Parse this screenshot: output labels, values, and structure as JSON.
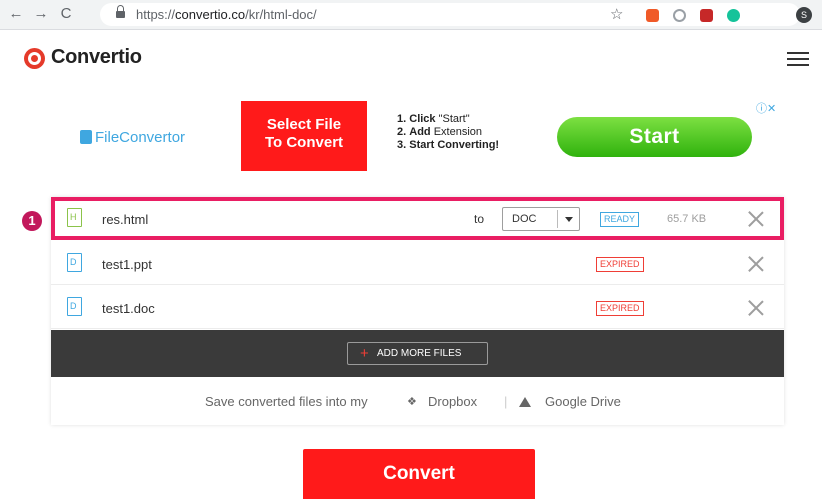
{
  "browser": {
    "url_prefix": "https://",
    "url_host": "convertio.co",
    "url_path": "/kr/html-doc/",
    "profile_initial": "S"
  },
  "site": {
    "logo": "Convertio"
  },
  "ad": {
    "brand": "FileConvertor",
    "cta_line1": "Select File",
    "cta_line2": "To Convert",
    "steps": [
      {
        "num": "1.",
        "bold": "Click",
        "rest": " \"Start\""
      },
      {
        "num": "2.",
        "bold": "Add",
        "rest": " Extension"
      },
      {
        "num": "3.",
        "bold": "Start Converting!",
        "rest": ""
      }
    ],
    "start_label": "Start",
    "adchoices": "ⓘ✕"
  },
  "files": [
    {
      "name": "res.html",
      "to_label": "to",
      "format": "DOC",
      "status": "READY",
      "size": "65.7 KB",
      "icon_letter": "H"
    },
    {
      "name": "test1.ppt",
      "status": "EXPIRED",
      "icon_letter": "D"
    },
    {
      "name": "test1.doc",
      "status": "EXPIRED",
      "icon_letter": "D"
    }
  ],
  "add_more": {
    "plus": "+",
    "label": "ADD MORE FILES"
  },
  "save": {
    "text": "Save converted files into my",
    "dropbox": "Dropbox",
    "separator": "|",
    "gdrive": "Google Drive"
  },
  "marker": "1",
  "convert_label": "Convert",
  "colors": {
    "accent_red": "#ff1a1a",
    "highlight_pink": "#e91e63",
    "ready_blue": "#3fa7e0",
    "expired_red": "#ef3e36"
  }
}
